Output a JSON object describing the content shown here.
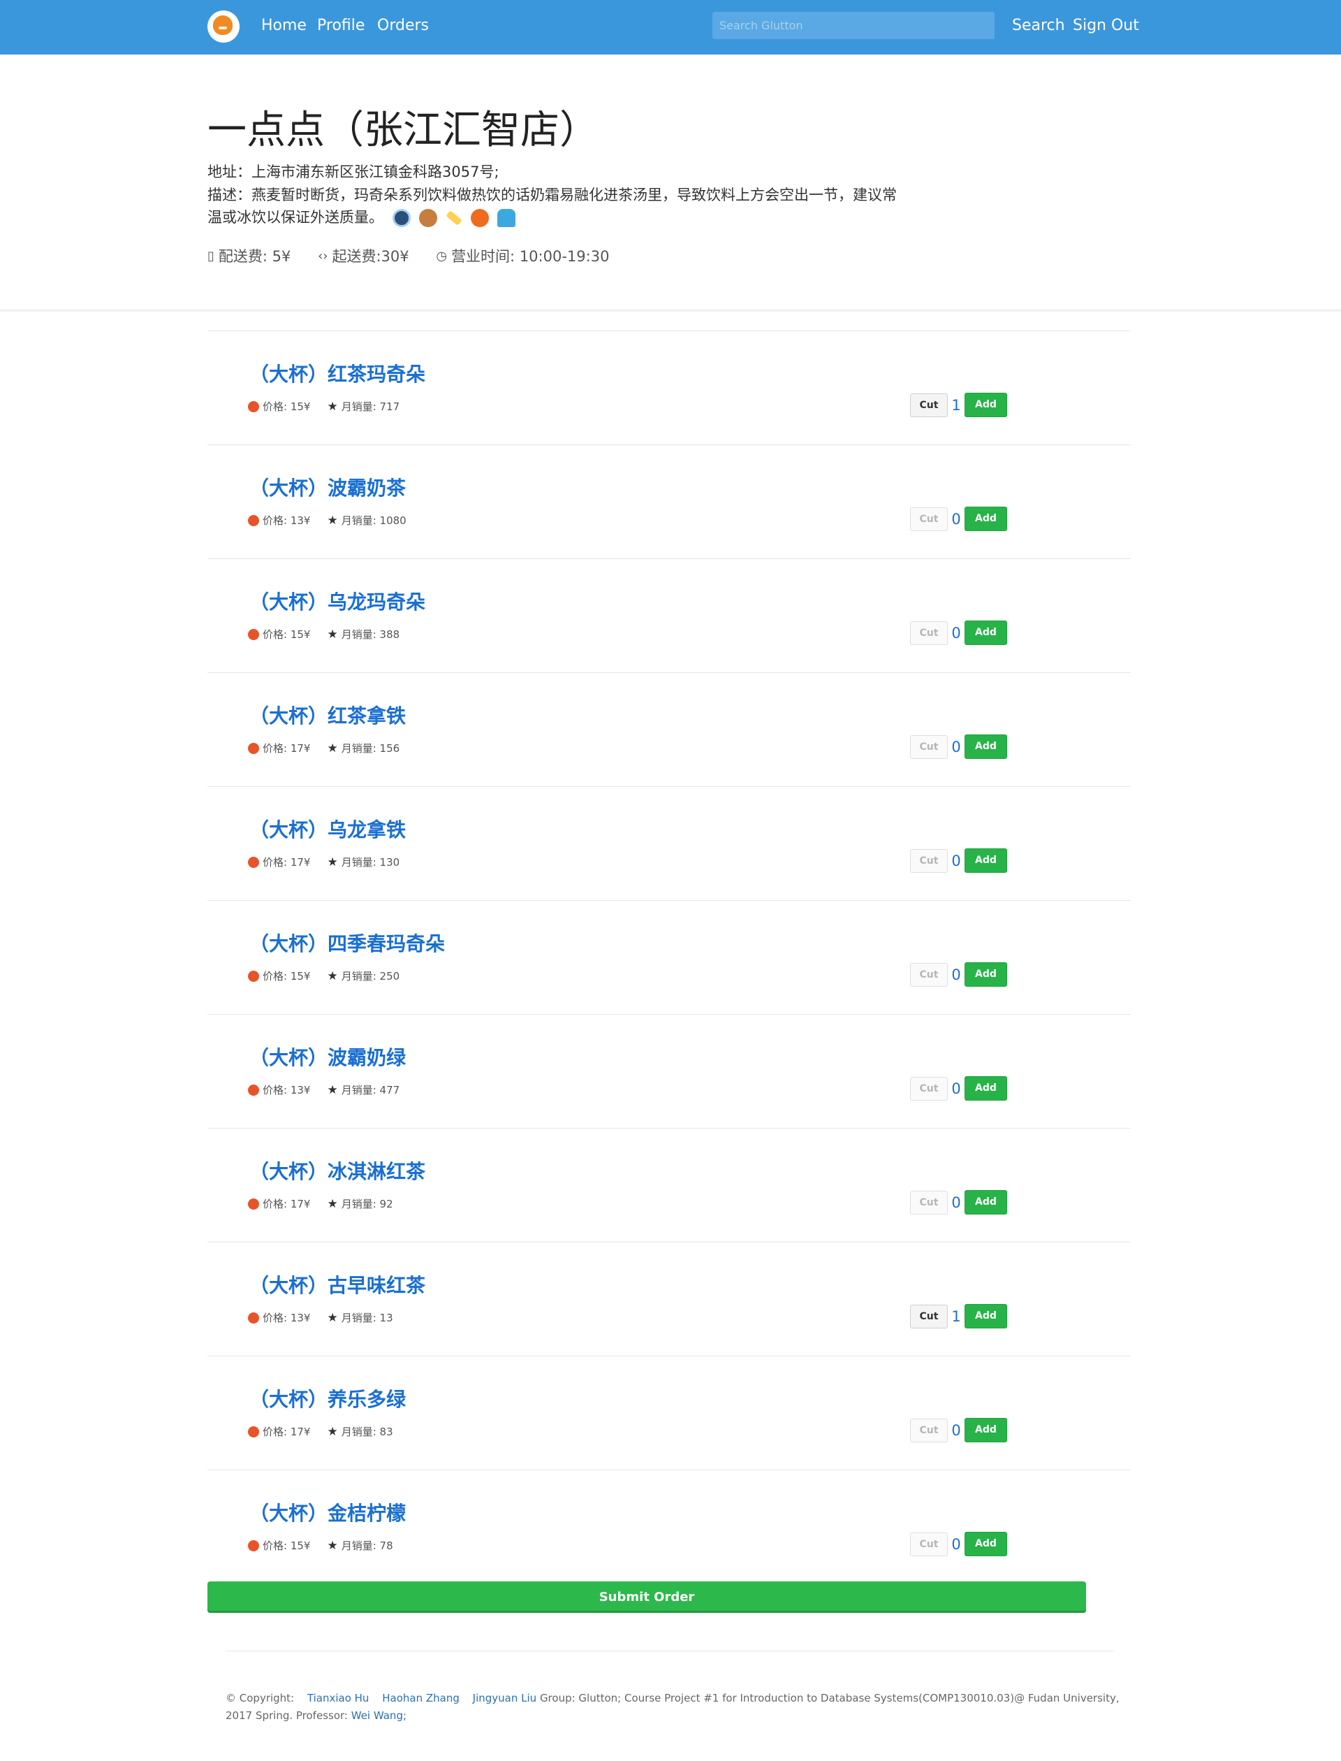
{
  "nav": {
    "home": "Home",
    "profile": "Profile",
    "orders": "Orders",
    "search_placeholder": "Search Glutton",
    "search_button": "Search",
    "sign_out": "Sign Out",
    "color": "#3b97dc"
  },
  "store": {
    "title": "一点点（张江汇智店）",
    "address": "地址：上海市浦东新区张江镇金科路3057号;",
    "description": "描述：燕麦暂时断货，玛奇朵系列饮料做热饮的话奶霜易融化进茶汤里，导致饮料上方会空出一节，建议常温或冰饮以保证外送质量。",
    "emoji_icons": [
      "sunglasses-face-icon",
      "monkey-face-icon",
      "pencil-icon",
      "orange-icon",
      "person-icon"
    ],
    "delivery_fee": "配送费: 5¥",
    "min_order": "起送费:30¥",
    "hours": "营业时间: 10:00-19:30"
  },
  "items": [
    {
      "name": "（大杯）红茶玛奇朵",
      "price": "价格: 15¥",
      "sales": "月销量: 717",
      "qty": "1",
      "cut": "Cut",
      "add": "Add"
    },
    {
      "name": "（大杯）波霸奶茶",
      "price": "价格: 13¥",
      "sales": "月销量: 1080",
      "qty": "0",
      "cut": "Cut",
      "add": "Add"
    },
    {
      "name": "（大杯）乌龙玛奇朵",
      "price": "价格: 15¥",
      "sales": "月销量: 388",
      "qty": "0",
      "cut": "Cut",
      "add": "Add"
    },
    {
      "name": "（大杯）红茶拿铁",
      "price": "价格: 17¥",
      "sales": "月销量: 156",
      "qty": "0",
      "cut": "Cut",
      "add": "Add"
    },
    {
      "name": "（大杯）乌龙拿铁",
      "price": "价格: 17¥",
      "sales": "月销量: 130",
      "qty": "0",
      "cut": "Cut",
      "add": "Add"
    },
    {
      "name": "（大杯）四季春玛奇朵",
      "price": "价格: 15¥",
      "sales": "月销量: 250",
      "qty": "0",
      "cut": "Cut",
      "add": "Add"
    },
    {
      "name": "（大杯）波霸奶绿",
      "price": "价格: 13¥",
      "sales": "月销量: 477",
      "qty": "0",
      "cut": "Cut",
      "add": "Add"
    },
    {
      "name": "（大杯）冰淇淋红茶",
      "price": "价格: 17¥",
      "sales": "月销量: 92",
      "qty": "0",
      "cut": "Cut",
      "add": "Add"
    },
    {
      "name": "（大杯）古早味红茶",
      "price": "价格: 13¥",
      "sales": "月销量: 13",
      "qty": "1",
      "cut": "Cut",
      "add": "Add"
    },
    {
      "name": "（大杯）养乐多绿",
      "price": "价格: 17¥",
      "sales": "月销量: 83",
      "qty": "0",
      "cut": "Cut",
      "add": "Add"
    },
    {
      "name": "（大杯）金桔柠檬",
      "price": "价格: 15¥",
      "sales": "月销量: 78",
      "qty": "0",
      "cut": "Cut",
      "add": "Add"
    }
  ],
  "submit_label": "Submit Order",
  "footer": {
    "copyright": "© Copyright:",
    "author1": "Tianxiao Hu",
    "author2": "Haohan Zhang",
    "author3": "Jingyuan Liu",
    "text": "Group: Glutton; Course Project #1 for Introduction to Database Systems(COMP130010.03)@ Fudan University, 2017 Spring. Professor:",
    "professor": "Wei Wang;"
  },
  "colors": {
    "link_blue": "#1a6fd3",
    "add_green": "#27b348",
    "price_dot": "#e8532a"
  }
}
